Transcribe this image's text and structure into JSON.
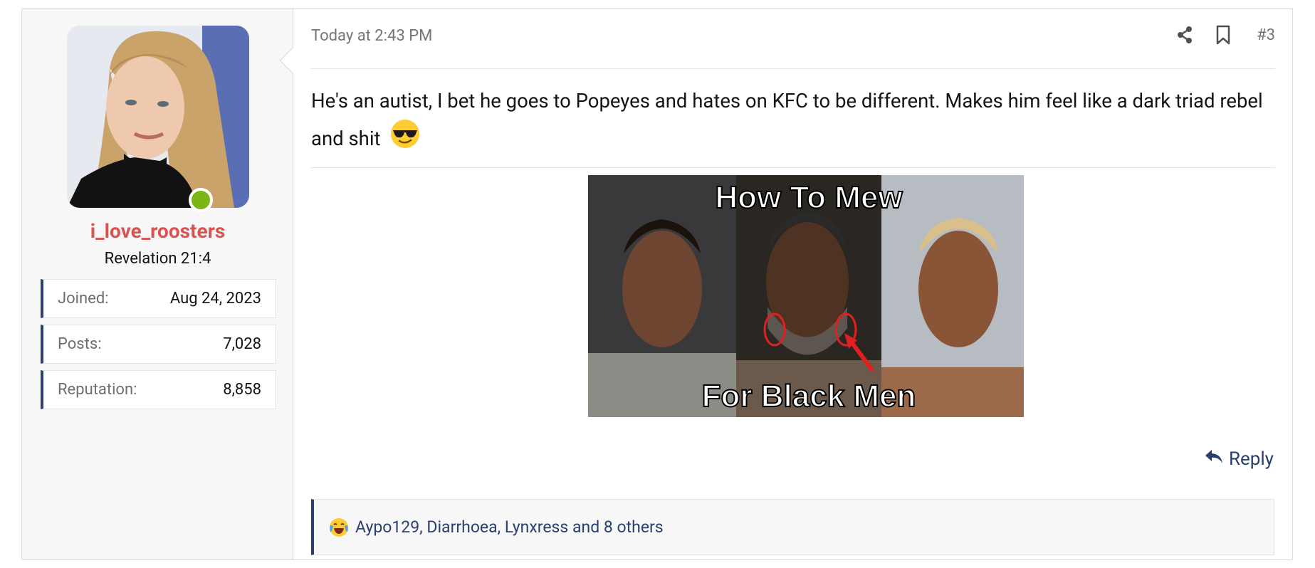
{
  "post": {
    "timestamp": "Today at 2:43 PM",
    "post_number": "#3",
    "body_text": "He's an autist, I bet he goes to Popeyes and hates on KFC to be different. Makes him feel like a dark triad rebel and shit",
    "body_emoji": "sunglasses-emoji",
    "attachment": {
      "caption_top": "How To Mew",
      "caption_bottom": "For Black Men"
    },
    "reply_label": "Reply",
    "reactions_text": "Aypo129, Diarrhoea, Lynxress and 8 others",
    "reaction_emoji": "crying-laughing-emoji"
  },
  "user": {
    "username": "i_love_roosters",
    "title": "Revelation 21:4",
    "online": true,
    "stats": [
      {
        "label": "Joined:",
        "value": "Aug 24, 2023"
      },
      {
        "label": "Posts:",
        "value": "7,028"
      },
      {
        "label": "Reputation:",
        "value": "8,858"
      }
    ]
  },
  "colors": {
    "username": "#d9534f",
    "accent": "#2b3f6e",
    "online": "#7cb518"
  }
}
